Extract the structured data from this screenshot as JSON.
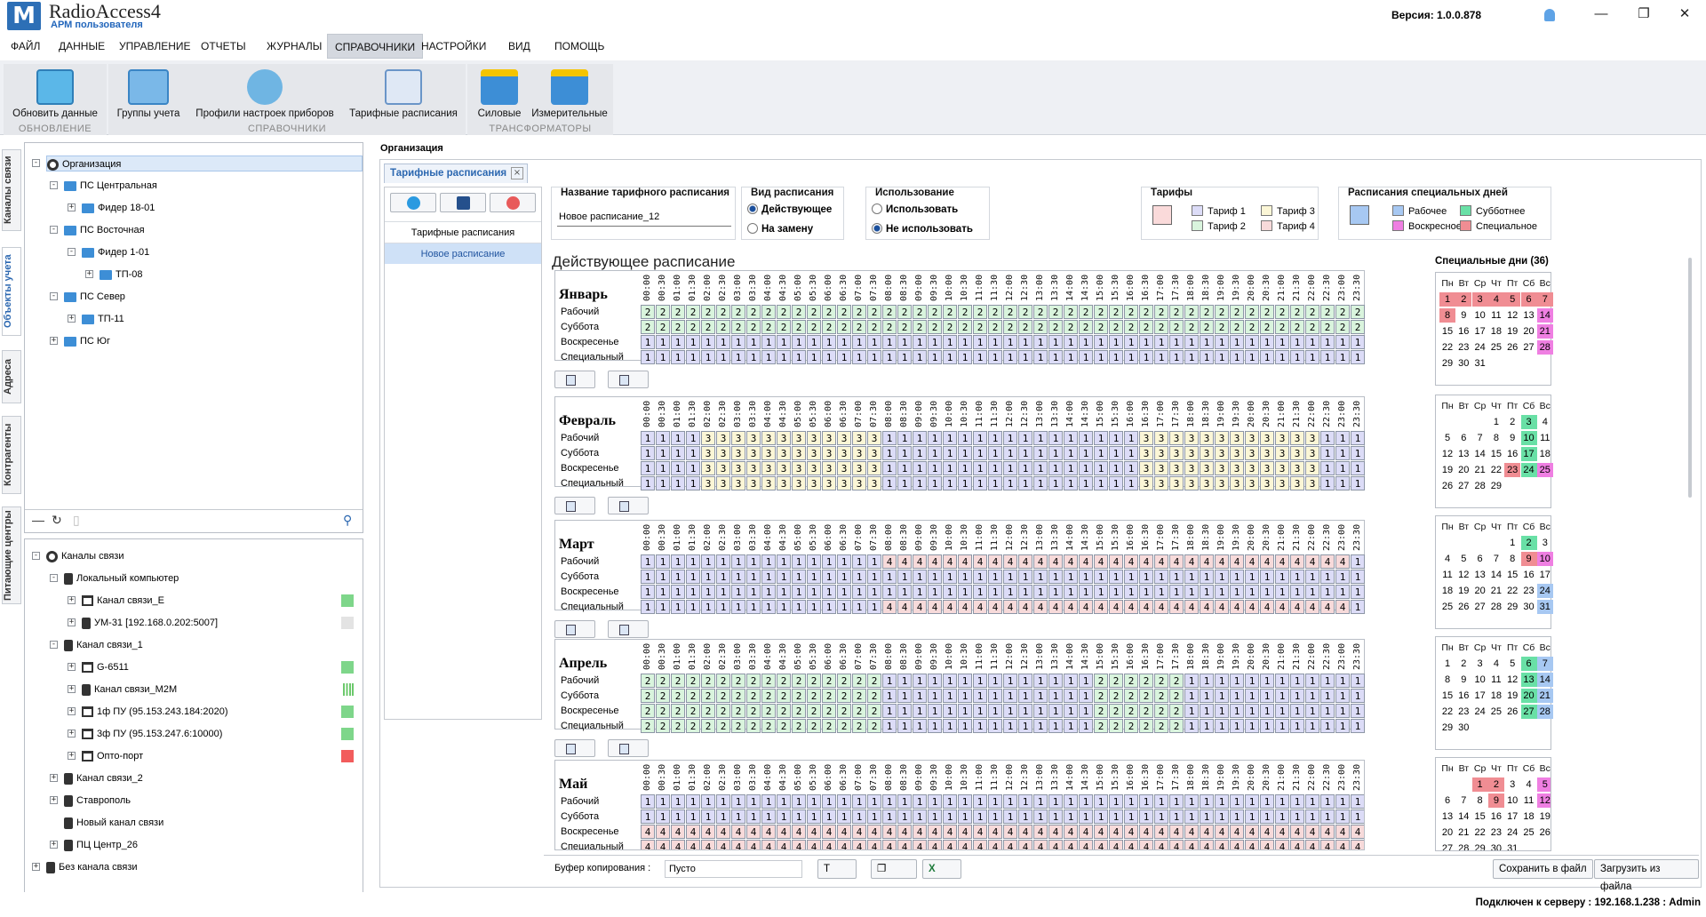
{
  "app": {
    "name": "RadioAccess4",
    "subtitle": "АРМ пользователя",
    "version": "Версия:  1.0.0.878"
  },
  "menu": [
    "ФАЙЛ",
    "ДАННЫЕ",
    "УПРАВЛЕНИЕ",
    "ОТЧЕТЫ",
    "ЖУРНАЛЫ",
    "СПРАВОЧНИКИ",
    "НАСТРОЙКИ",
    "ВИД",
    "ПОМОЩЬ"
  ],
  "menu_active": "СПРАВОЧНИКИ",
  "ribbon": {
    "groups": [
      {
        "label": "ОБНОВЛЕНИЕ",
        "buttons": [
          "Обновить данные"
        ]
      },
      {
        "label": "СПРАВОЧНИКИ",
        "buttons": [
          "Группы учета",
          "Профили настроек приборов",
          "Тарифные расписания"
        ]
      },
      {
        "label": "ТРАНСФОРМАТОРЫ",
        "buttons": [
          "Силовые",
          "Измерительные"
        ]
      }
    ]
  },
  "side_tabs": [
    "Каналы связи",
    "Объекты учета",
    "Адреса",
    "Контрагенты",
    "Питающие центры"
  ],
  "org_tree": [
    {
      "label": "Организация",
      "level": 0,
      "icon": "gear-icon",
      "expand": "-",
      "selected": true
    },
    {
      "label": "ПС Центральная",
      "level": 1,
      "icon": "folder-icon",
      "expand": "-"
    },
    {
      "label": "Фидер 18-01",
      "level": 2,
      "icon": "folder-icon",
      "expand": "+"
    },
    {
      "label": "ПС Восточная",
      "level": 1,
      "icon": "folder-icon",
      "expand": "-"
    },
    {
      "label": "Фидер 1-01",
      "level": 2,
      "icon": "folder-icon",
      "expand": "-"
    },
    {
      "label": "ТП-08",
      "level": 3,
      "icon": "folder-icon",
      "expand": "+"
    },
    {
      "label": "ПС Север",
      "level": 1,
      "icon": "folder-icon",
      "expand": "-"
    },
    {
      "label": "ТП-11",
      "level": 2,
      "icon": "folder-icon",
      "expand": "+"
    },
    {
      "label": "ПС Юг",
      "level": 1,
      "icon": "folder-icon",
      "expand": "+"
    }
  ],
  "channel_tree": [
    {
      "label": "Каналы связи",
      "level": 0,
      "icon": "network-icon",
      "expand": "-",
      "status": null
    },
    {
      "label": "Локальный компьютер",
      "level": 1,
      "icon": "device-icon",
      "expand": "-",
      "status": null
    },
    {
      "label": "Канал связи_E",
      "level": 2,
      "icon": "port-icon",
      "expand": "+",
      "status": "#7ed68a"
    },
    {
      "label": "УМ-31 [192.168.0.202:5007]",
      "level": 2,
      "icon": "device-icon",
      "expand": "+",
      "status": "#e3e3e3"
    },
    {
      "label": "Канал связи_1",
      "level": 1,
      "icon": "device-icon",
      "expand": "-",
      "status": null
    },
    {
      "label": "G-6511",
      "level": 2,
      "icon": "port-icon",
      "expand": "+",
      "status": "#7ed68a"
    },
    {
      "label": "Канал связи_M2M",
      "level": 2,
      "icon": "device-icon",
      "expand": "+",
      "status": "signal"
    },
    {
      "label": "1ф ПУ (95.153.243.184:2020)",
      "level": 2,
      "icon": "port-icon",
      "expand": "+",
      "status": "#7ed68a"
    },
    {
      "label": "3ф ПУ (95.153.247.6:10000)",
      "level": 2,
      "icon": "port-icon",
      "expand": "+",
      "status": "#7ed68a"
    },
    {
      "label": "Опто-порт",
      "level": 2,
      "icon": "port-icon",
      "expand": "+",
      "status": "#f25c5c"
    },
    {
      "label": "Канал связи_2",
      "level": 1,
      "icon": "device-icon",
      "expand": "+",
      "status": null
    },
    {
      "label": "Ставрополь",
      "level": 1,
      "icon": "device-icon",
      "expand": "+",
      "status": null
    },
    {
      "label": "Новый канал связи",
      "level": 1,
      "icon": "device-icon",
      "expand": "",
      "status": null
    },
    {
      "label": "ПЦ Центр_26",
      "level": 1,
      "icon": "device-icon",
      "expand": "+",
      "status": null
    },
    {
      "label": "Без канала связи",
      "level": 0,
      "icon": "device-icon",
      "expand": "+",
      "status": null
    }
  ],
  "breadcrumb": "Организация",
  "doc_tab": "Тарифные расписания",
  "list": {
    "items": [
      "Тарифные расписания",
      "Новое расписание"
    ],
    "selected": "Новое расписание"
  },
  "form": {
    "name_label": "Название тарифного расписания",
    "name_value": "Новое расписание_12",
    "kind_label": "Вид расписания",
    "kind_options": [
      "Действующее",
      "На замену"
    ],
    "kind_selected": "Действующее",
    "usage_label": "Использование",
    "usage_options": [
      "Использовать",
      "Не использовать"
    ],
    "usage_selected": "Не использовать",
    "tariffs_label": "Тарифы",
    "tariffs": [
      {
        "name": "Тариф 1",
        "color": "#dcdcf7"
      },
      {
        "name": "Тариф 2",
        "color": "#d9f4dd"
      },
      {
        "name": "Тариф 3",
        "color": "#fbf6d6"
      },
      {
        "name": "Тариф 4",
        "color": "#f7dada"
      }
    ],
    "special_label": "Расписания специальных дней",
    "special_types": [
      {
        "name": "Рабочее",
        "color": "#a7c8f2"
      },
      {
        "name": "Воскресное",
        "color": "#ef7fe2"
      },
      {
        "name": "Субботнее",
        "color": "#69e0a6"
      },
      {
        "name": "Специальное",
        "color": "#f08d93"
      }
    ]
  },
  "schedule": {
    "title": "Действующее расписание",
    "times": [
      "00:00",
      "00:30",
      "01:00",
      "01:30",
      "02:00",
      "02:30",
      "03:00",
      "03:30",
      "04:00",
      "04:30",
      "05:00",
      "05:30",
      "06:00",
      "06:30",
      "07:00",
      "07:30",
      "08:00",
      "08:30",
      "09:00",
      "09:30",
      "10:00",
      "10:30",
      "11:00",
      "11:30",
      "12:00",
      "12:30",
      "13:00",
      "13:30",
      "14:00",
      "14:30",
      "15:00",
      "15:30",
      "16:00",
      "16:30",
      "17:00",
      "17:30",
      "18:00",
      "18:30",
      "19:00",
      "19:30",
      "20:00",
      "20:30",
      "21:00",
      "21:30",
      "22:00",
      "22:30",
      "23:00",
      "23:30"
    ],
    "row_labels": [
      "Рабочий",
      "Суббота",
      "Воскресенье",
      "Специальный"
    ],
    "months": [
      {
        "name": "Январь",
        "rows": [
          "222222222222222222222222222222222222222222222222",
          "222222222222222222222222222222222222222222222222",
          "111111111111111111111111111111111111111111111111",
          "111111111111111111111111111111111111111111111111"
        ]
      },
      {
        "name": "Февраль",
        "rows": [
          "111133333333333311111111111111111333333333333111",
          "111133333333333311111111111111111333333333333111",
          "111133333333333311111111111111111333333333333111",
          "111133333333333311111111111111111333333333333111"
        ]
      },
      {
        "name": "Март",
        "rows": [
          "111111111111111144444444444444444444444444444441",
          "111111111111111111111111111111111111111111111111",
          "111111111111111111111111111111111111111111111111",
          "111111111111111144444444444444444444444444444441"
        ]
      },
      {
        "name": "Апрель",
        "rows": [
          "222222222222222211111111111111222222111111111111",
          "222222222222222211111111111111222222111111111111",
          "222222222222222211111111111111222222111111111111",
          "222222222222222211111111111111222222111111111111"
        ]
      },
      {
        "name": "Май",
        "rows": [
          "111111111111111111111111111111111111111111111111",
          "111111111111111111111111111111111111111111111111",
          "444444444444444444444444444444444444444444444444",
          "444444444444444444444444444444444444444444444444"
        ]
      }
    ]
  },
  "special_days": {
    "title": "Специальные дни (36)",
    "weekdays": [
      "Пн",
      "Вт",
      "Ср",
      "Чт",
      "Пт",
      "Сб",
      "Вс"
    ],
    "months": [
      {
        "offset": 0,
        "days": 31,
        "marks": {
          "1": "r",
          "2": "r",
          "3": "r",
          "4": "r",
          "5": "r",
          "6": "r",
          "7": "r",
          "8": "r",
          "14": "m",
          "21": "m",
          "28": "m"
        }
      },
      {
        "offset": 3,
        "days": 29,
        "marks": {
          "3": "g",
          "10": "g",
          "17": "g",
          "23": "r",
          "24": "g",
          "25": "m"
        }
      },
      {
        "offset": 4,
        "days": 31,
        "marks": {
          "2": "g",
          "9": "r",
          "10": "m",
          "24": "b",
          "31": "b"
        }
      },
      {
        "offset": 0,
        "days": 30,
        "marks": {
          "6": "g",
          "7": "b",
          "13": "g",
          "14": "b",
          "20": "g",
          "21": "b",
          "27": "g",
          "28": "b"
        }
      },
      {
        "offset": 2,
        "days": 31,
        "marks": {
          "1": "r",
          "2": "r",
          "5": "m",
          "9": "r",
          "12": "m"
        }
      }
    ]
  },
  "bottom": {
    "clip_label": "Буфер копирования :",
    "clip_value": "Пусто",
    "save_button": "Сохранить в файл",
    "load_button": "Загрузить из файла"
  },
  "status": "Подключен к серверу : 192.168.1.238 : Admin"
}
